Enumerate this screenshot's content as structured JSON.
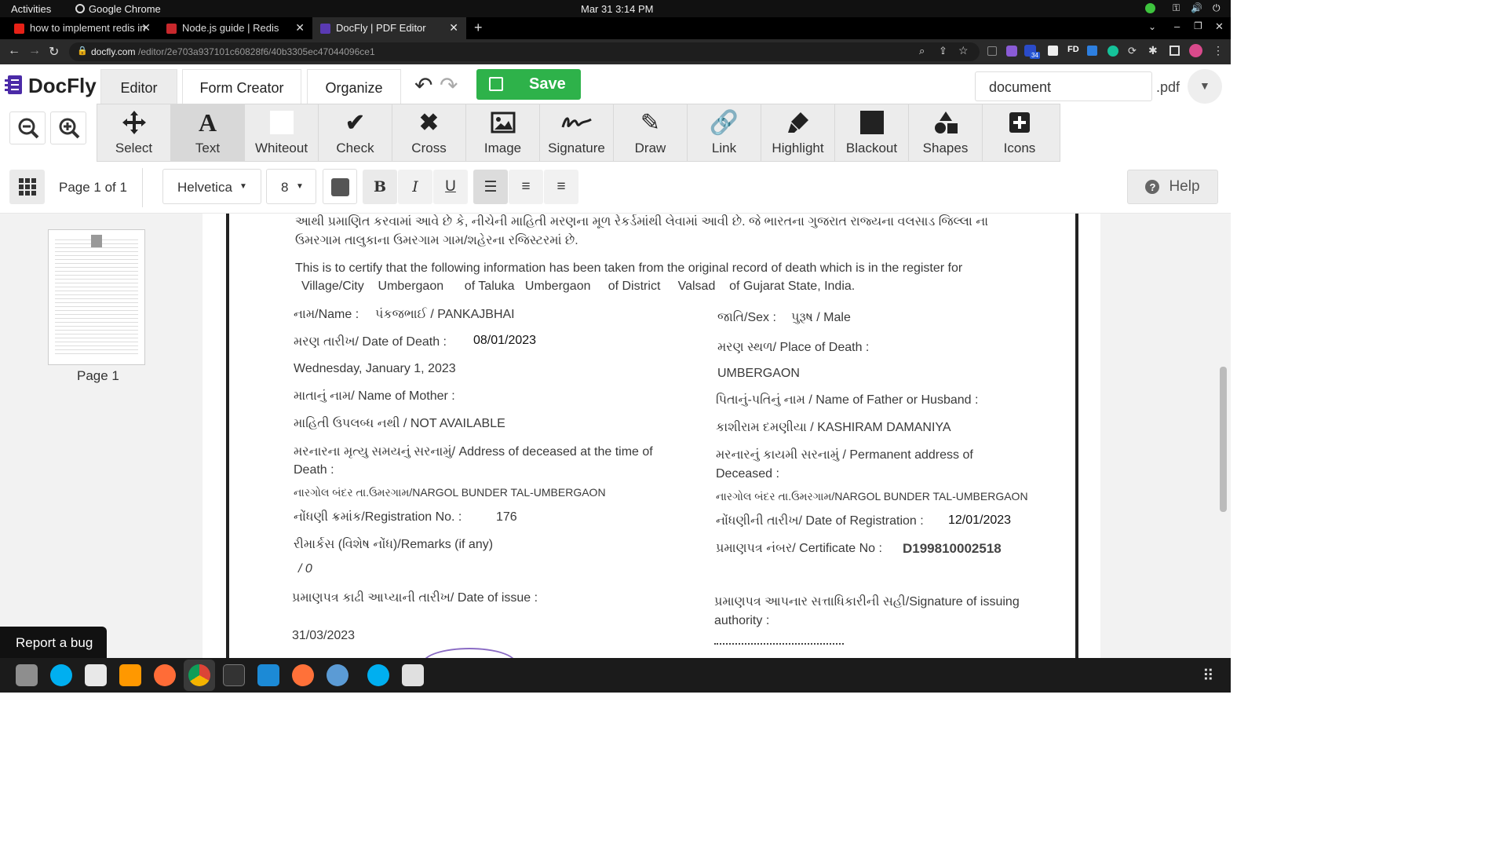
{
  "system": {
    "activities": "Activities",
    "app": "Google Chrome",
    "datetime": "Mar 31  3:14 PM"
  },
  "browser": {
    "tabs": [
      {
        "title": "how to implement redis in"
      },
      {
        "title": "Node.js guide | Redis"
      },
      {
        "title": "DocFly | PDF Editor"
      }
    ],
    "url_host": "docfly.com",
    "url_path": "/editor/2e703a937101c60828f6/40b3305ec47044096ce1",
    "ext_badge": "34"
  },
  "app": {
    "logo": "DocFly",
    "tabs": [
      "Editor",
      "Form Creator",
      "Organize"
    ],
    "save": "Save",
    "filename": "document",
    "ext": ".pdf"
  },
  "tools": [
    "Select",
    "Text",
    "Whiteout",
    "Check",
    "Cross",
    "Image",
    "Signature",
    "Draw",
    "Link",
    "Highlight",
    "Blackout",
    "Shapes",
    "Icons"
  ],
  "format": {
    "page": "Page 1 of 1",
    "font": "Helvetica",
    "size": "8",
    "help": "Help"
  },
  "sidebar": {
    "thumb_label": "Page 1",
    "report": "Report a bug"
  },
  "doc": {
    "l1": "આથી પ્રમાણિત કરવામાં આવે છે કે, નીચેની માહિતી મરણના મૂળ રેકર્ડમાંથી લેવામાં આવી છે. જે ભારતના ગુજરાત રાજ્યના વલસાડ જિલ્લા ના",
    "l2": "ઉમરગામ તાલુકાના ઉમરગામ ગામ/શહેરના રજિસ્ટરમાં છે.",
    "l3": "This is to certify that the following information has been taken from the original record of death which is in the register for",
    "l4": "Village/City    Umbergaon      of Taluka   Umbergaon     of District     Valsad    of Gujarat State, India.",
    "name_label": "નામ/Name :",
    "name_val": "પંકજભાઈ / PANKAJBHAI",
    "sex_label": "જાતિ/Sex :",
    "sex_val": "પુરૂષ / Male",
    "dod_label": "મરણ તારીખ/ Date of Death :",
    "dod_val": "08/01/2023",
    "pod_label": "મરણ સ્થળ/ Place of Death :",
    "weekday": "Wednesday, January 1, 2023",
    "place_val": "UMBERGAON",
    "mother_label": "માતાનું નામ/ Name of Mother :",
    "father_label": "પિતાનું-પતિનું નામ / Name of Father  or Husband  :",
    "mother_val": "માહિતી ઉપલબ્ધ નથી / NOT AVAILABLE",
    "father_val": "કાશીરામ દમણીયા / KASHIRAM DAMANIYA",
    "addr_label1": "મરનારના મૃત્યુ સમયનું સરનામું/ Address of deceased at the time of",
    "addr_label2": "Death :",
    "perm_label1": "મરનારનું કાયમી સરનામું /  Permanent  address of",
    "perm_label2": "Deceased :",
    "addr_val": "નારગોલ બંદર તા.ઉમરગામ/NARGOL BUNDER TAL-UMBERGAON",
    "perm_val": "નારગોલ બંદર તા.ઉમરગામ/NARGOL BUNDER TAL-UMBERGAON",
    "reg_label": "નોંધણી ક્રમાંક/Registration No.  :",
    "reg_val": "176",
    "regdate_label": "નોંધણીની તારીખ/ Date of  Registration :",
    "regdate_val": "12/01/2023",
    "remarks_label": "રીમાર્કસ (વિશેષ નોંધ)/Remarks (if any)",
    "cert_label": "પ્રમાણપત્ર નંબર/ Certificate No :",
    "cert_val": "D199810002518",
    "remarks_val": "/ 0",
    "issue_label": "પ્રમાણપત્ર કાઢી આપ્યાની તારીખ/ Date of issue :",
    "sign_label1": "પ્રમાણપત્ર આપનાર સત્તાધિકારીની સહી/Signature of issuing",
    "sign_label2": "authority :",
    "issue_val": "31/03/2023"
  },
  "colors": {
    "save_green": "#2eb24a",
    "logo_purple": "#4b2aa7",
    "chrome_dark": "#2a2a2a"
  }
}
